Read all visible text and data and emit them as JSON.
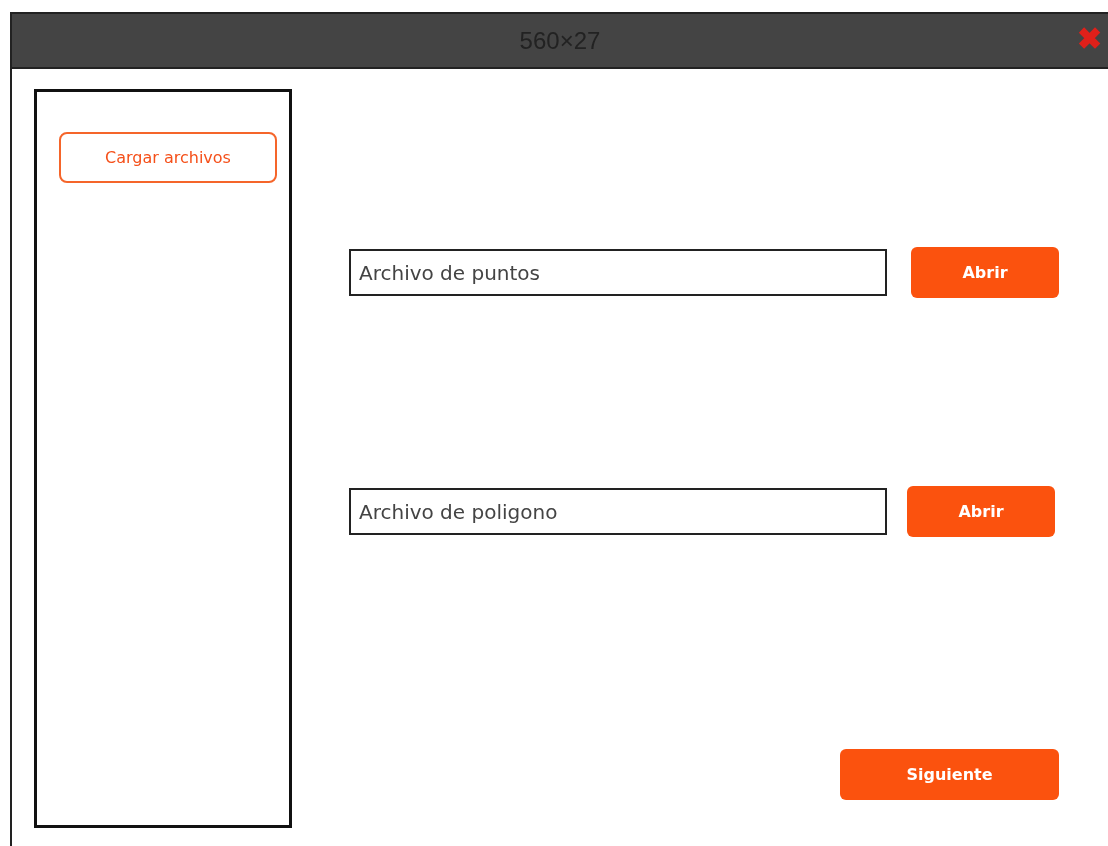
{
  "window": {
    "title": "560×27",
    "close": "✖"
  },
  "sidebar": {
    "buttons": [
      "Cargar archivos"
    ]
  },
  "file_rows": [
    {
      "placeholder": "Archivo de puntos",
      "button": "Abrir"
    },
    {
      "placeholder": "Archivo de poligono",
      "button": "Abrir"
    }
  ],
  "next_button": "Siguiente"
}
